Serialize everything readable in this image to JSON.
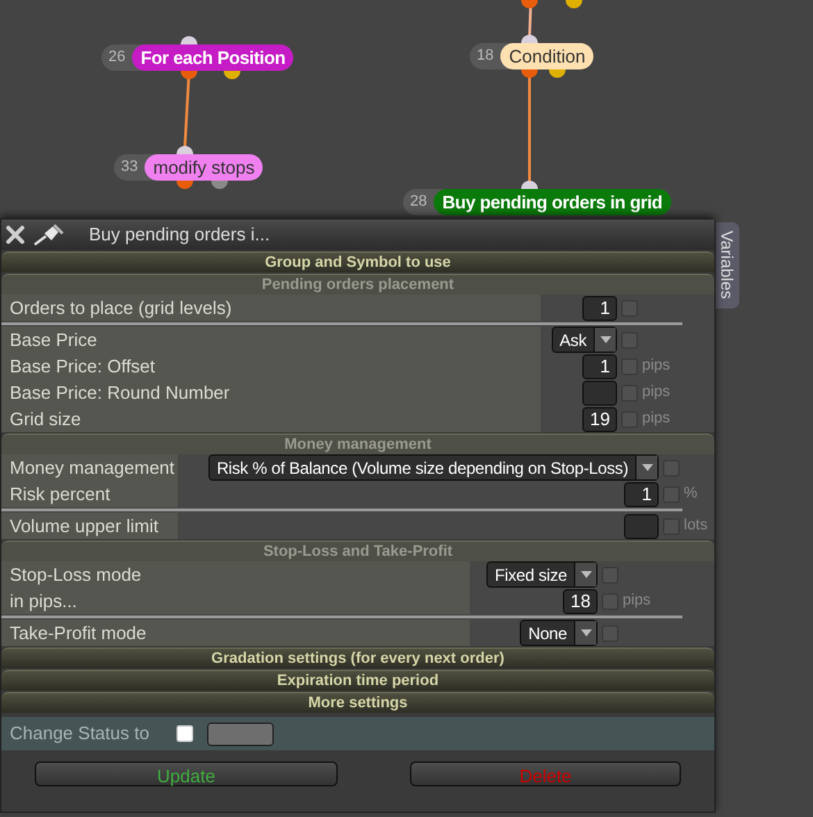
{
  "nodes": [
    {
      "number": "26",
      "label": "For each Position",
      "color": "#c51cc5"
    },
    {
      "number": "33",
      "label": "modify stops",
      "color": "#f080f0"
    },
    {
      "number": "18",
      "label": "Condition",
      "color": "#ffe0b0"
    },
    {
      "number": "28",
      "label": "Buy pending orders in grid",
      "color": "#0a7a0a"
    }
  ],
  "panel": {
    "title": "Buy pending orders i...",
    "side_tab": "Variables",
    "sections": [
      {
        "title": "Group and Symbol to use",
        "expanded": false
      },
      {
        "title": "Pending orders placement",
        "expanded": true,
        "groups": [
          [
            {
              "kind": "number",
              "label": "Orders to place (grid levels)",
              "value": "1",
              "checked": false
            }
          ],
          [
            {
              "kind": "select",
              "label": "Base Price",
              "value": "Ask",
              "checked": false
            },
            {
              "kind": "number",
              "label": "Base Price: Offset",
              "value": "1",
              "unit": "pips",
              "checked": false
            },
            {
              "kind": "number",
              "label": "Base Price: Round Number",
              "unit": "pips",
              "checked": false
            },
            {
              "kind": "number",
              "label": "Grid size",
              "value": "19",
              "unit": "pips",
              "checked": false
            }
          ]
        ]
      },
      {
        "title": "Money management",
        "expanded": true,
        "groups": [
          [
            {
              "kind": "select",
              "label": "Money management",
              "value": "Risk % of Balance (Volume size depending on Stop-Loss)",
              "checked": false
            },
            {
              "kind": "number",
              "label": "Risk percent",
              "value": "1",
              "unit": "%",
              "checked": false
            }
          ],
          [
            {
              "kind": "number",
              "label": "Volume upper limit",
              "unit": "lots",
              "checked": false
            }
          ]
        ]
      },
      {
        "title": "Stop-Loss and Take-Profit",
        "expanded": true,
        "groups": [
          [
            {
              "kind": "select",
              "label": "Stop-Loss mode",
              "value": "Fixed size",
              "checked": false
            },
            {
              "kind": "number",
              "label": "in pips...",
              "value": "18",
              "unit": "pips",
              "checked": false
            }
          ],
          [
            {
              "kind": "select",
              "label": "Take-Profit mode",
              "value": "None",
              "checked": false
            }
          ]
        ]
      },
      {
        "title": "Gradation settings (for every next order)",
        "expanded": false
      },
      {
        "title": "Expiration time period",
        "expanded": false
      },
      {
        "title": "More settings",
        "expanded": false
      }
    ],
    "status": {
      "label": "Change Status to",
      "checked": false
    },
    "buttons": [
      {
        "label": "Update",
        "kind": "confirm"
      },
      {
        "label": "Delete",
        "kind": "danger"
      }
    ]
  }
}
